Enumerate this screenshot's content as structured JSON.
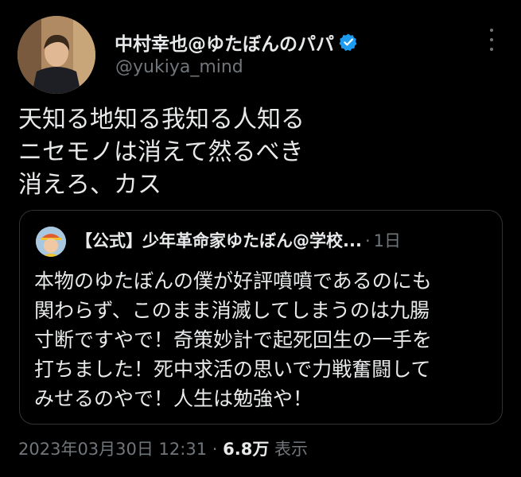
{
  "author": {
    "display_name": "中村幸也@ゆたぼんのパパ",
    "handle": "@yukiya_mind",
    "verified_icon": "verified-badge-icon",
    "verified_color": "#1d9bf0"
  },
  "more_icon": "more-horizontal-icon",
  "tweet": {
    "lines": [
      "天知る地知る我知る人知る",
      "ニセモノは消えて然るべき",
      "消えろ、カス"
    ]
  },
  "quote": {
    "author_name": "【公式】少年革命家ゆたぼん@学校...",
    "separator": "·",
    "time": "1日",
    "lines": [
      "本物のゆたぼんの僕が好評噴噴であるのにも",
      "関わらず、このまま消滅してしまうのは九腸",
      "寸断ですやで！奇策妙計で起死回生の一手を",
      "打ちました！死中求活の思いで力戦奮闘して",
      "みせるのやで！人生は勉強や！"
    ]
  },
  "meta": {
    "timestamp": "2023年03月30日 12:31",
    "separator": "·",
    "views_count": "6.8万",
    "views_label": "表示"
  },
  "colors": {
    "background": "#000000",
    "text": "#e7e9ea",
    "muted": "#71767b",
    "border": "#2f3336"
  }
}
